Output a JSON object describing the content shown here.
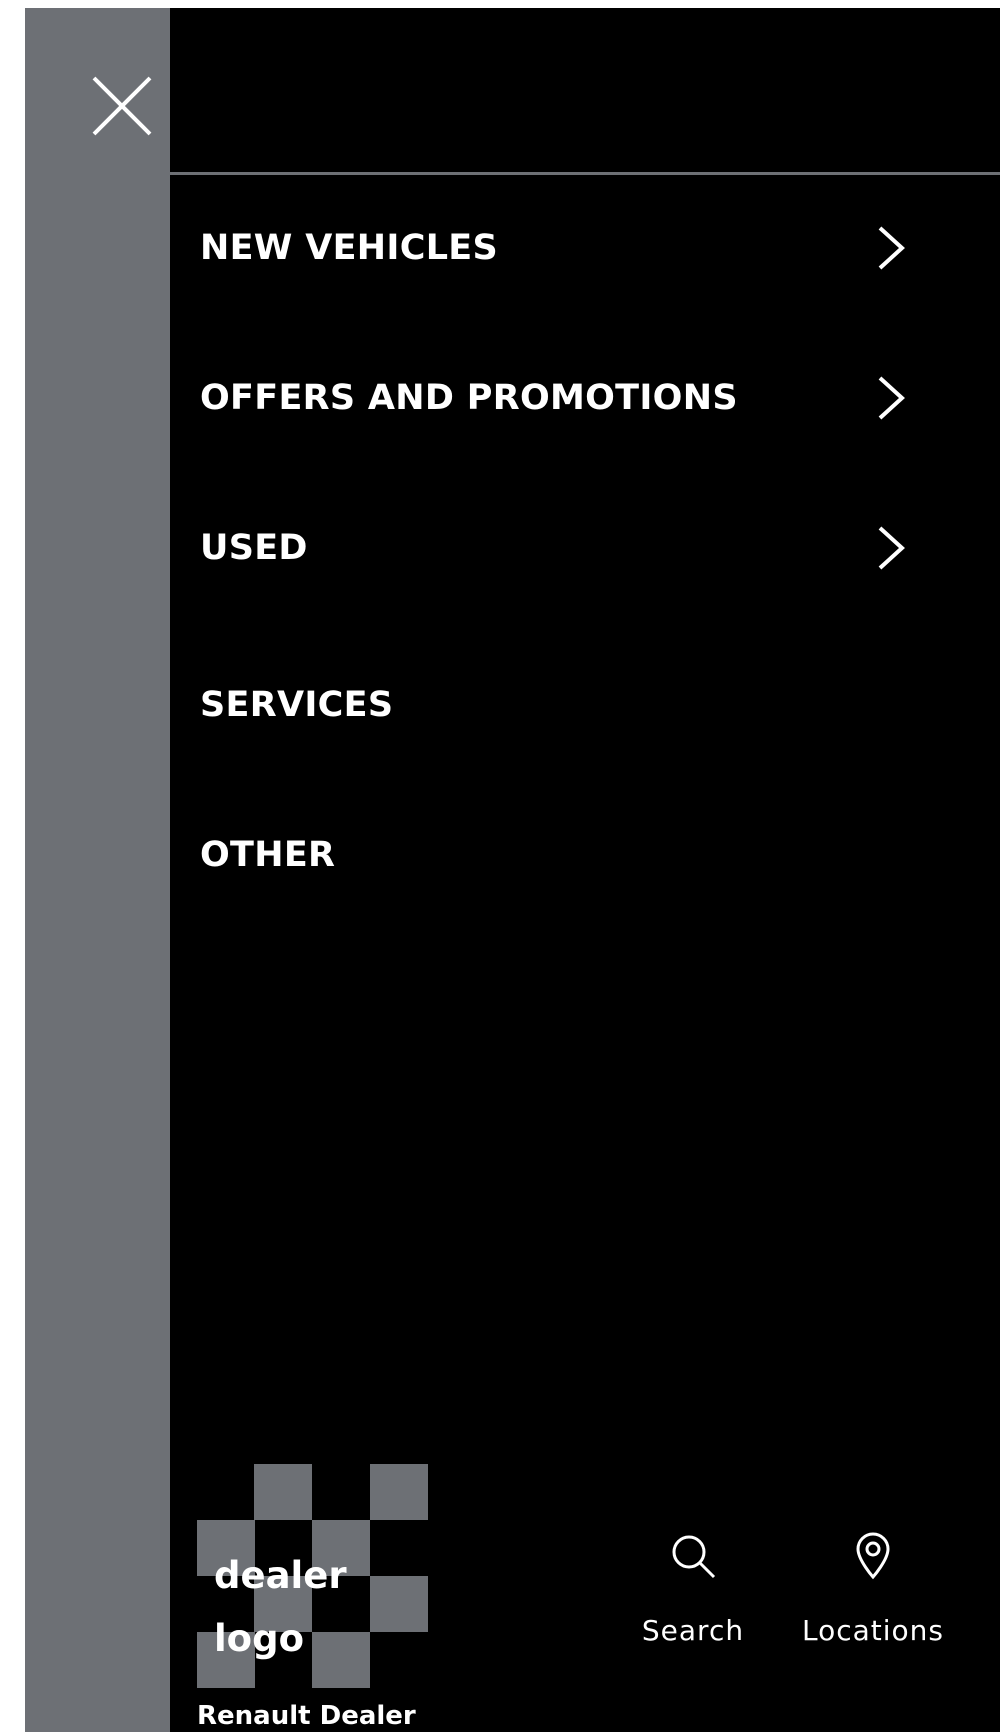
{
  "colors": {
    "rail_background": "#6d7075",
    "panel_background": "#000000",
    "text": "#ffffff",
    "checker_square": "#6d7075",
    "divider": "#6d7075"
  },
  "close_button": {
    "icon": "close-icon"
  },
  "menu": {
    "items": [
      {
        "label": "NEW VEHICLES",
        "has_submenu": true,
        "icon": "chevron-right-icon"
      },
      {
        "label": "OFFERS AND PROMOTIONS",
        "has_submenu": true,
        "icon": "chevron-right-icon"
      },
      {
        "label": "USED",
        "has_submenu": true,
        "icon": "chevron-right-icon"
      },
      {
        "label": "SERVICES",
        "has_submenu": false
      },
      {
        "label": "OTHER",
        "has_submenu": false
      }
    ]
  },
  "footer": {
    "dealer_logo": {
      "line1": "dealer",
      "line2": "logo"
    },
    "dealer_name": "Renault Dealer",
    "search": {
      "label": "Search",
      "icon": "search-icon"
    },
    "locations": {
      "label": "Locations",
      "icon": "location-pin-icon"
    }
  }
}
